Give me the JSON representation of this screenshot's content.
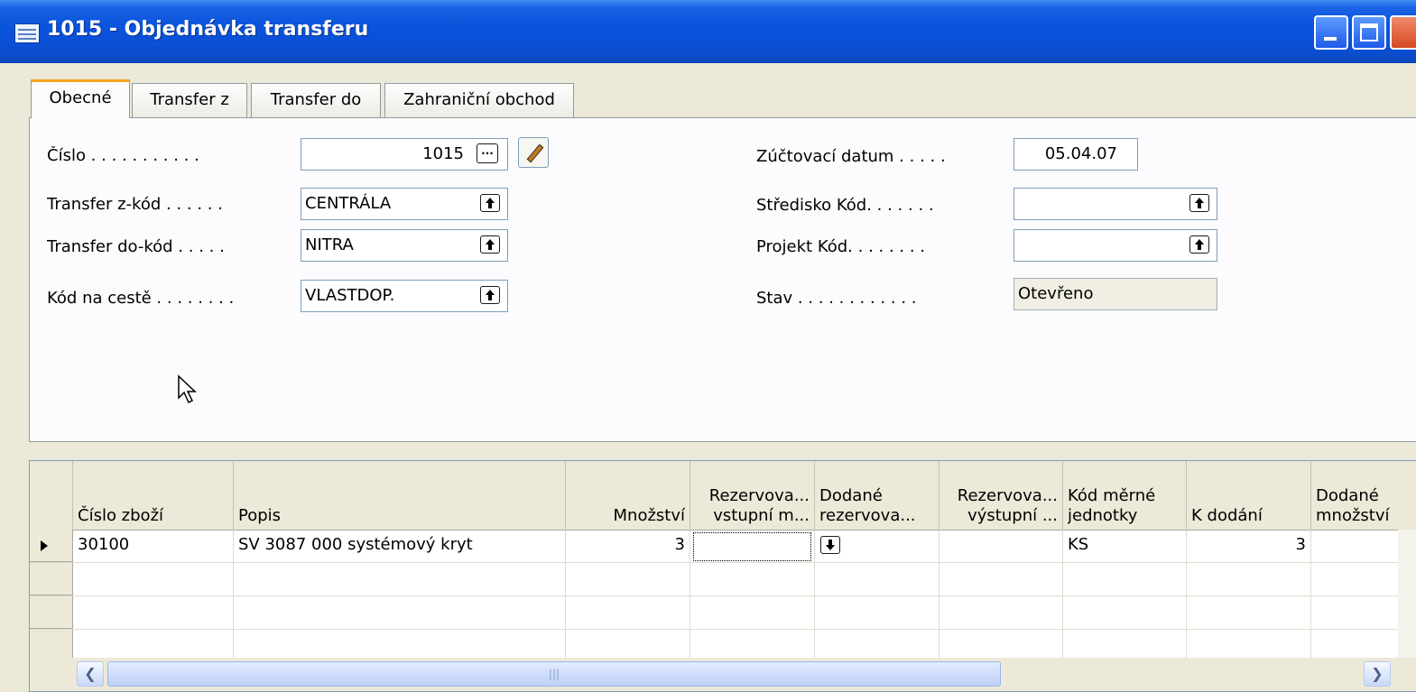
{
  "window": {
    "title": "1015 - Objednávka transferu"
  },
  "tabs": [
    {
      "label": "Obecné"
    },
    {
      "label": "Transfer z"
    },
    {
      "label": "Transfer do"
    },
    {
      "label": "Zahraniční obchod"
    }
  ],
  "form": {
    "cislo_label": "Číslo . . . . . . . . . . .",
    "cislo_value": "1015",
    "transfer_z_label": "Transfer z-kód . . . . . .",
    "transfer_z_value": "CENTRÁLA",
    "transfer_do_label": "Transfer do-kód . . . . .",
    "transfer_do_value": "NITRA",
    "kod_na_ceste_label": "Kód na cestě . . . . . . . .",
    "kod_na_ceste_value": "VLASTDOP.",
    "zuctovaci_datum_label": "Zúčtovací datum . . . . .",
    "zuctovaci_datum_value": "05.04.07",
    "stredisko_label": "Středisko Kód. . . . . . .",
    "stredisko_value": "",
    "projekt_label": "Projekt Kód. . . . . . . .",
    "projekt_value": "",
    "stav_label": "Stav . . . . . . . . . . . .",
    "stav_value": "Otevřeno"
  },
  "grid": {
    "columns": [
      {
        "line1": "",
        "line2": "Číslo zboží"
      },
      {
        "line1": "",
        "line2": "Popis"
      },
      {
        "line1": "",
        "line2": "Množství"
      },
      {
        "line1": "Rezervova...",
        "line2": "vstupní m..."
      },
      {
        "line1": "Dodané",
        "line2": "rezervova..."
      },
      {
        "line1": "Rezervova...",
        "line2": "výstupní ..."
      },
      {
        "line1": "Kód měrné",
        "line2": "jednotky"
      },
      {
        "line1": "",
        "line2": "K dodání"
      },
      {
        "line1": "Dodané",
        "line2": "množství"
      }
    ],
    "rows": [
      {
        "cislo": "30100",
        "popis": "SV 3087 000 systémový kryt",
        "mnozstvi": "3",
        "rez_vst": "",
        "dod_rez": "",
        "rez_vyst": "",
        "kod_mj": "KS",
        "k_dodani": "3",
        "dod_mn": ""
      }
    ]
  },
  "icons": {
    "title": "form-icon",
    "lookup": "lookup-arrow-icon",
    "pencil": "pencil-icon"
  }
}
